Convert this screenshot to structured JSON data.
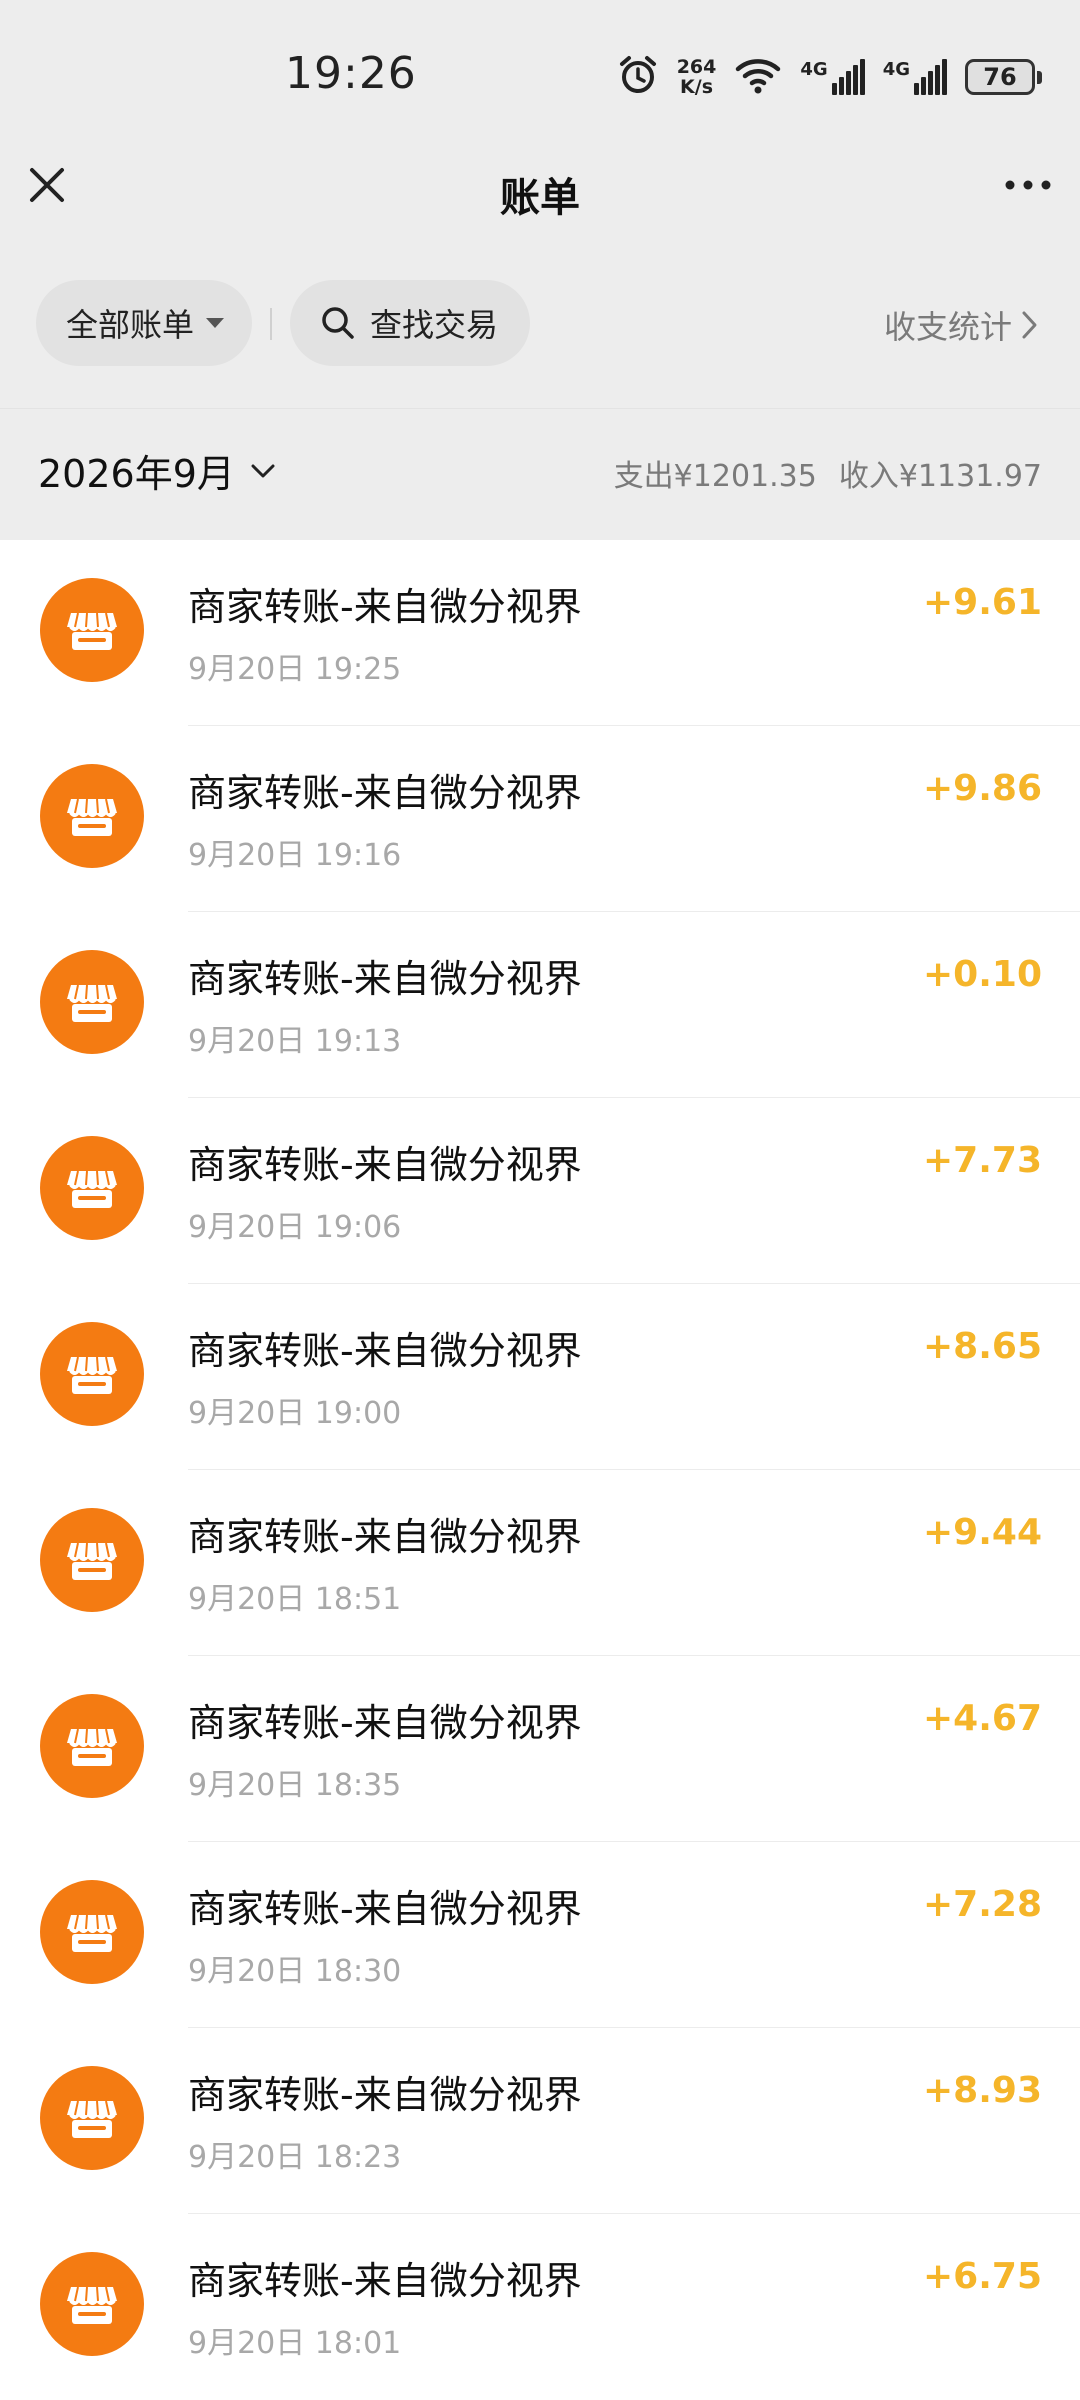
{
  "status_bar": {
    "time": "19:26",
    "net_speed_value": "264",
    "net_speed_unit": "K/s",
    "signal1_label": "4G",
    "signal2_label": "4G",
    "battery": "76",
    "icons": [
      "alarm-icon",
      "wifi-icon",
      "signal-icon",
      "battery-icon"
    ]
  },
  "nav": {
    "title": "账单"
  },
  "filters": {
    "all_bills": "全部账单",
    "search": "查找交易",
    "stats": "收支统计"
  },
  "month": {
    "label": "2026年9月",
    "expense": "支出¥1201.35",
    "income": "收入¥1131.97"
  },
  "colors": {
    "icon_bg": "#f47b12",
    "amount": "#f5b52a",
    "page_bg": "#ededed"
  },
  "transactions": [
    {
      "title": "商家转账-来自微分视界",
      "time": "9月20日 19:25",
      "amount": "+9.61"
    },
    {
      "title": "商家转账-来自微分视界",
      "time": "9月20日 19:16",
      "amount": "+9.86"
    },
    {
      "title": "商家转账-来自微分视界",
      "time": "9月20日 19:13",
      "amount": "+0.10"
    },
    {
      "title": "商家转账-来自微分视界",
      "time": "9月20日 19:06",
      "amount": "+7.73"
    },
    {
      "title": "商家转账-来自微分视界",
      "time": "9月20日 19:00",
      "amount": "+8.65"
    },
    {
      "title": "商家转账-来自微分视界",
      "time": "9月20日 18:51",
      "amount": "+9.44"
    },
    {
      "title": "商家转账-来自微分视界",
      "time": "9月20日 18:35",
      "amount": "+4.67"
    },
    {
      "title": "商家转账-来自微分视界",
      "time": "9月20日 18:30",
      "amount": "+7.28"
    },
    {
      "title": "商家转账-来自微分视界",
      "time": "9月20日 18:23",
      "amount": "+8.93"
    },
    {
      "title": "商家转账-来自微分视界",
      "time": "9月20日 18:01",
      "amount": "+6.75"
    }
  ]
}
